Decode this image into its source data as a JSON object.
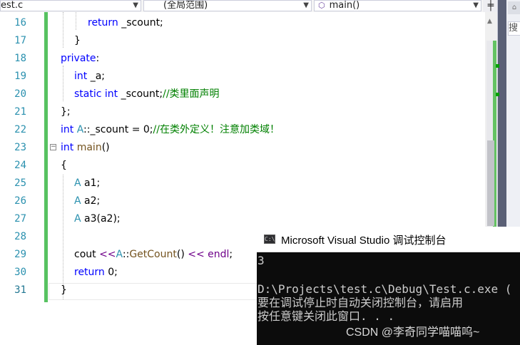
{
  "navbar": {
    "file_combo": "est.c",
    "scope_combo": "(全局范围)",
    "member_combo": "main()",
    "split_symbol": "╪"
  },
  "editor": {
    "lines": [
      {
        "n": "16",
        "indent": 2
      },
      {
        "n": "17",
        "indent": 1
      },
      {
        "n": "18",
        "indent": 0
      },
      {
        "n": "19",
        "indent": 1
      },
      {
        "n": "20",
        "indent": 1
      },
      {
        "n": "21",
        "indent": 0
      },
      {
        "n": "22",
        "indent": 0
      },
      {
        "n": "23",
        "indent": 0
      },
      {
        "n": "24",
        "indent": 0
      },
      {
        "n": "25",
        "indent": 1
      },
      {
        "n": "26",
        "indent": 1
      },
      {
        "n": "27",
        "indent": 1
      },
      {
        "n": "28",
        "indent": 0
      },
      {
        "n": "29",
        "indent": 1
      },
      {
        "n": "30",
        "indent": 1
      },
      {
        "n": "31",
        "indent": 0
      }
    ],
    "tokens": {
      "l16_return": "return",
      "l16_rest": " _scount;",
      "l17": "}",
      "l18_private": "private",
      "l18_colon": ":",
      "l19_int": "int",
      "l19_rest": " _a;",
      "l20_static": "static",
      "l20_int": " int",
      "l20_rest": " _scount;",
      "l20_comment": "//类里面声明",
      "l21": "};",
      "l22_int": "int",
      "l22_A": " A",
      "l22_rest": "::_scount = 0;",
      "l22_comment": "//在类外定义！注意加类域！",
      "l23_int": "int",
      "l23_main": " main",
      "l23_rest": "()",
      "l24": "{",
      "l25_A": "A",
      "l25_rest": " a1;",
      "l26_A": "A",
      "l26_rest": " a2;",
      "l27_A": "A",
      "l27_rest": " a3(a2);",
      "l29_cout": "cout ",
      "l29_op1": "<<",
      "l29_A": "A",
      "l29_scope": "::",
      "l29_fn": "GetCount",
      "l29_paren": "() ",
      "l29_op2": "<<",
      "l29_endl": " endl",
      "l29_semi": ";",
      "l30_return": "return",
      "l30_rest": " 0;",
      "l31": "}"
    }
  },
  "right_panel": {
    "search_char": "搜"
  },
  "console": {
    "title": "Microsoft Visual Studio 调试控制台",
    "icon_text": "C:\\",
    "output": "3",
    "path_line": "D:\\Projects\\test.c\\Debug\\Test.c.exe (",
    "msg_line1": "要在调试停止时自动关闭控制台，请启用",
    "msg_line2": "按任意键关闭此窗口. . ."
  },
  "watermark": "CSDN @李奇同学喵喵呜~"
}
